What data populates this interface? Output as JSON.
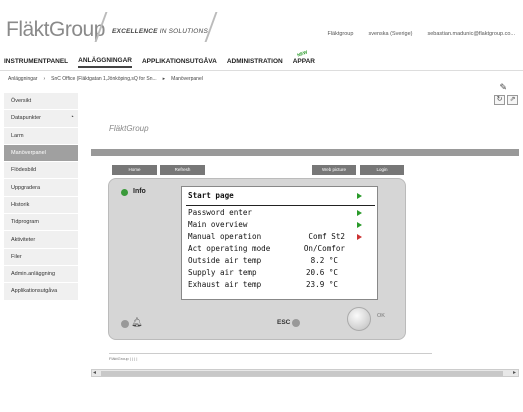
{
  "header": {
    "logo_text": "FläktGroup",
    "tagline_bold": "EXCELLENCE",
    "tagline_rest": " IN SOLUTIONS",
    "links": [
      "Fläktgroup",
      "svenska (Sverige)",
      "sebastian.madunic@flaktgroup.co..."
    ]
  },
  "nav": {
    "items": [
      "INSTRUMENTPANEL",
      "ANLÄGGNINGAR",
      "APPLIKATIONSUTGÅVA",
      "ADMINISTRATION",
      "APPAR"
    ],
    "active": "ANLÄGGNINGAR",
    "new_badge": "NEW"
  },
  "breadcrumb": [
    "Anläggningar",
    "SnC Office (Fläktgatan 1,Jönköping,sQ for Sn...",
    "Manöverpanel"
  ],
  "sidebar": {
    "items": [
      "Översikt",
      "Datapunkter",
      "Larm",
      "Manöverpanel",
      "Flödesbild",
      "Uppgradera",
      "Historik",
      "Tidprogram",
      "Aktiviteter",
      "Filer",
      "Admin.anläggning",
      "Applikationsutgåva"
    ],
    "active": "Manöverpanel"
  },
  "main": {
    "logo_text": "FläktGroup",
    "buttons": [
      "Home",
      "Refresh",
      "Web picture",
      "Login"
    ],
    "footer": "FläktGroup  |  |  |  |"
  },
  "panel": {
    "info_label": "Info",
    "esc_label": "ESC",
    "ok_label": "OK",
    "screen_rows": [
      {
        "label": "Start page",
        "value": "",
        "arrow": "green"
      },
      {
        "label": "Password enter",
        "value": "",
        "arrow": "green"
      },
      {
        "label": "Main overview",
        "value": "",
        "arrow": "green"
      },
      {
        "label": "Manual operation",
        "value": "Comf St2",
        "arrow": "red"
      },
      {
        "label": "Act operating mode",
        "value": "On/Comfor",
        "arrow": ""
      },
      {
        "label": "Outside air temp",
        "value": "8.2 °C",
        "arrow": ""
      },
      {
        "label": "Supply air temp",
        "value": "20.6 °C",
        "arrow": ""
      },
      {
        "label": "Exhaust air temp",
        "value": "23.9 °C",
        "arrow": ""
      }
    ]
  },
  "colors": {
    "led_green": "#3a9a3a",
    "arrow_red": "#cc3333",
    "arrow_green": "#2a9a2a"
  }
}
